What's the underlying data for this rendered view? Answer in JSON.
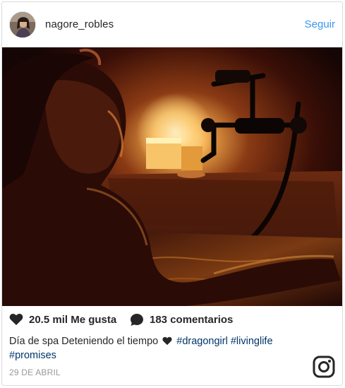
{
  "header": {
    "username": "nagore_robles",
    "follow_label": "Seguir"
  },
  "post": {
    "photo_icon": "bath-photo",
    "likes_label": "20.5 mil Me gusta",
    "comments_label": "183 comentarios",
    "caption": {
      "text_before": "Día de spa Deteniendo el tiempo",
      "heart_icon": "heart-icon",
      "hashtags": [
        "#dragongirl",
        "#livinglife",
        "#promises"
      ]
    },
    "date": "29 DE ABRIL"
  },
  "icons": {
    "heart": "heart-icon",
    "comment": "comment-bubble-icon",
    "brand": "instagram-logo-icon"
  },
  "colors": {
    "link": "#3897f0",
    "hashtag": "#003569",
    "text": "#262626",
    "muted": "#999999"
  }
}
